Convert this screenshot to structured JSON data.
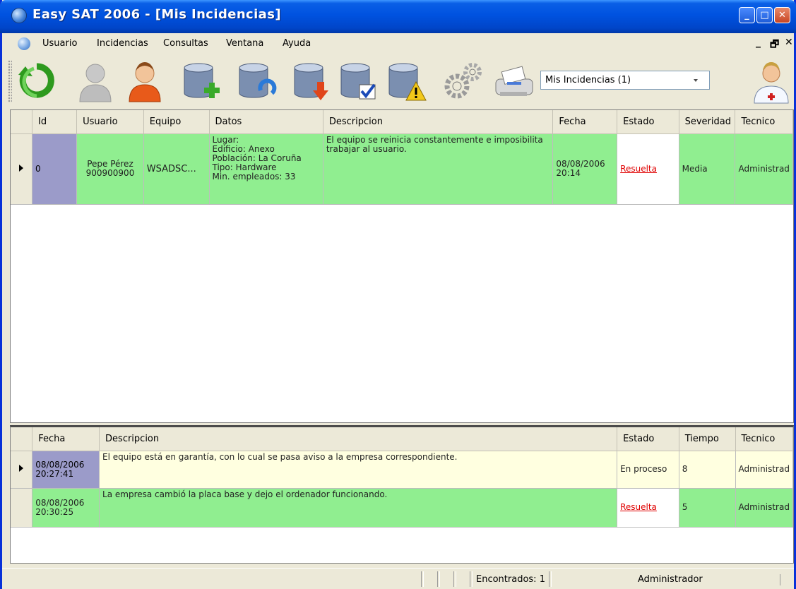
{
  "window": {
    "title": "Easy SAT 2006 - [Mis Incidencias]"
  },
  "menu": {
    "items": [
      "Usuario",
      "Incidencias",
      "Consultas",
      "Ventana",
      "Ayuda"
    ],
    "mdi_controls": [
      "_",
      "🗗",
      "✕"
    ]
  },
  "toolbar": {
    "buttons": [
      "refresh-icon",
      "user-gray-icon",
      "user-orange-icon",
      "db-add-icon",
      "db-refresh-icon",
      "db-down-icon",
      "db-check-icon",
      "db-warning-icon",
      "gears-icon",
      "printer-icon"
    ],
    "combo_value": "Mis Incidencias (1)",
    "right_icon": "doctor-icon"
  },
  "incidents": {
    "columns": [
      "Id",
      "Usuario",
      "Equipo",
      "Datos",
      "Descripcion",
      "Fecha",
      "Estado",
      "Severidad",
      "Tecnico"
    ],
    "rows": [
      {
        "id": "0",
        "usuario": "Pepe Pérez\n900900900",
        "equipo": "WSADSC...",
        "datos": "Lugar:\nEdificio: Anexo\nPoblación: La Coruña\nTipo: Hardware\nMin. empleados: 33",
        "descripcion": "El equipo se reinicia constantemente e imposibilita trabajar al usuario.",
        "fecha": "08/08/2006\n20:14",
        "estado": "Resuelta",
        "severidad": "Media",
        "tecnico": "Administrad"
      }
    ]
  },
  "history": {
    "columns": [
      "Fecha",
      "Descripcion",
      "Estado",
      "Tiempo",
      "Tecnico"
    ],
    "rows": [
      {
        "fecha": "08/08/2006\n20:27:41",
        "descripcion": "El equipo está en garantía, con lo cual se pasa aviso a la empresa correspondiente.",
        "estado": "En proceso",
        "tiempo": "8",
        "tecnico": "Administrad"
      },
      {
        "fecha": "08/08/2006\n20:30:25",
        "descripcion": "La empresa cambió la placa base y dejo el ordenador funcionando.",
        "estado": "Resuelta",
        "tiempo": "5",
        "tecnico": "Administrad"
      }
    ]
  },
  "status": {
    "found": "Encontrados: 1",
    "user": "Administrador"
  },
  "colors": {
    "titlebar": "#0052e0",
    "row_green": "#90ee90",
    "row_cream": "#ffffe0",
    "id_cell": "#9b9bc9",
    "link_red": "#e00000"
  }
}
